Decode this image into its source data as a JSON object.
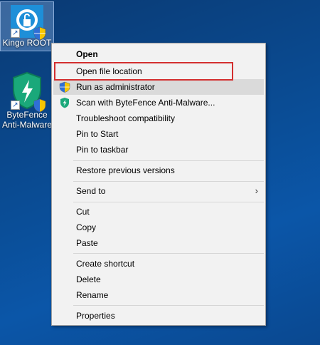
{
  "desktop": {
    "icons": [
      {
        "label": "Kingo ROOT",
        "icon": "kingo-root-icon"
      },
      {
        "label_line1": "ByteFence",
        "label_line2": "Anti-Malware",
        "icon": "bytefence-icon"
      }
    ]
  },
  "menu": {
    "open": "Open",
    "open_file_location": "Open file location",
    "run_as_admin": "Run as administrator",
    "scan_bytefence": "Scan with ByteFence Anti-Malware...",
    "troubleshoot": "Troubleshoot compatibility",
    "pin_start": "Pin to Start",
    "pin_taskbar": "Pin to taskbar",
    "restore_versions": "Restore previous versions",
    "send_to": "Send to",
    "cut": "Cut",
    "copy": "Copy",
    "paste": "Paste",
    "create_shortcut": "Create shortcut",
    "delete": "Delete",
    "rename": "Rename",
    "properties": "Properties"
  },
  "colors": {
    "highlight": "#d32f2f",
    "hover": "#dadada"
  }
}
